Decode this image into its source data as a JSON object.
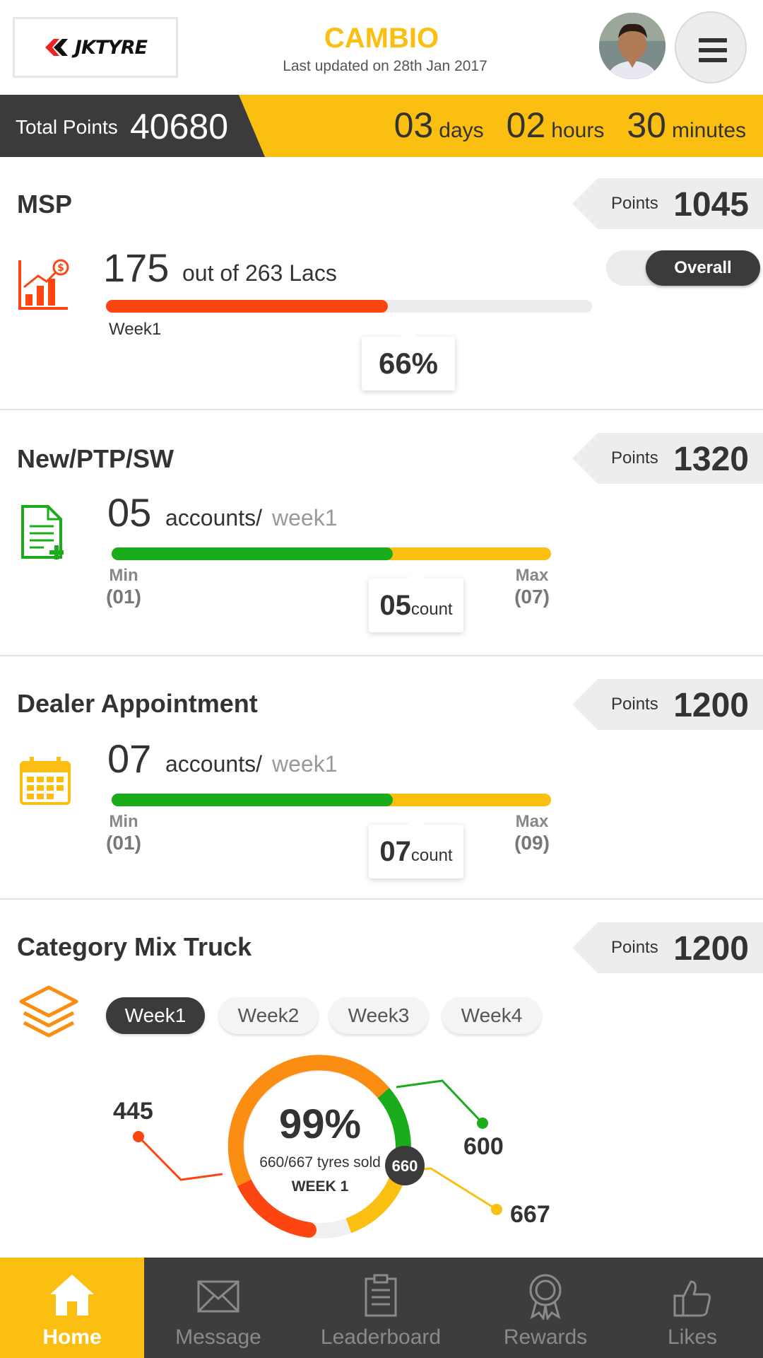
{
  "header": {
    "logo_text": "JKTYRE",
    "title": "CAMBIO",
    "subtitle": "Last updated on 28th Jan 2017"
  },
  "pointsbar": {
    "label": "Total Points",
    "value": "40680",
    "days": "03",
    "days_unit": "days",
    "hours": "02",
    "hours_unit": "hours",
    "minutes": "30",
    "minutes_unit": "minutes"
  },
  "msp": {
    "title": "MSP",
    "points_label": "Points",
    "points": "1045",
    "value": "175",
    "unit": "out of 263 Lacs",
    "progress_fraction": 0.58,
    "week_label": "Week1",
    "percent": "66%",
    "toggle_label": "Overall",
    "accent": "#fd4512"
  },
  "newptp": {
    "title": "New/PTP/SW",
    "points_label": "Points",
    "points": "1320",
    "value": "05",
    "unit": "accounts/",
    "unit_week": "week1",
    "progress_fraction": 0.64,
    "min_label": "Min",
    "min_value": "(01)",
    "max_label": "Max",
    "max_value": "(07)",
    "count": "05",
    "count_unit": "count"
  },
  "dealer": {
    "title": "Dealer Appointment",
    "points_label": "Points",
    "points": "1200",
    "value": "07",
    "unit": "accounts/",
    "unit_week": "week1",
    "progress_fraction": 0.64,
    "min_label": "Min",
    "min_value": "(01)",
    "max_label": "Max",
    "max_value": "(09)",
    "count": "07",
    "count_unit": "count"
  },
  "category": {
    "title": "Category Mix Truck",
    "points_label": "Points",
    "points": "1200",
    "weeks": [
      "Week1",
      "Week2",
      "Week3",
      "Week4"
    ],
    "percent": "99%",
    "detail": "660/667 tyres sold",
    "week_caption": "WEEK 1",
    "marker": "660",
    "label_left": "445",
    "label_top_right": "600",
    "label_bottom_right": "667"
  },
  "nav": {
    "items": [
      "Home",
      "Message",
      "Leaderboard",
      "Rewards",
      "Likes"
    ]
  },
  "colors": {
    "accent_yellow": "#fbbf12",
    "dark": "#3b3b3b",
    "green": "#1aac1a",
    "orange": "#fd4512",
    "donut_orange": "#fb8d12"
  }
}
